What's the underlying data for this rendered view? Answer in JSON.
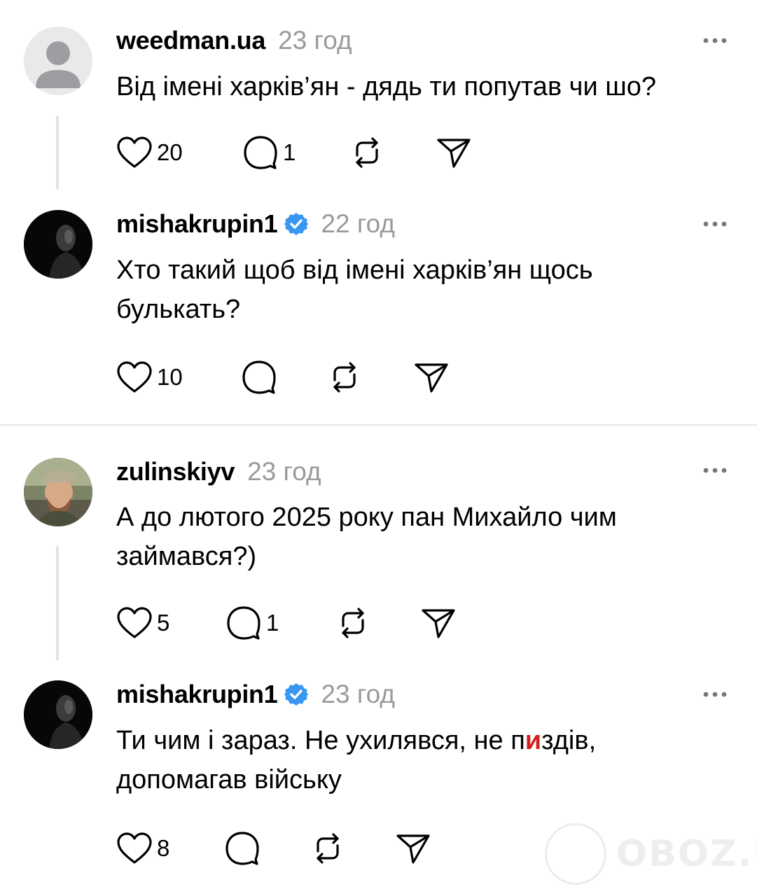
{
  "comments": [
    {
      "username": "weedman.ua",
      "time": "23 год",
      "text": "Від імені харків’ян - дядь ти попутав чи шо?",
      "likes": "20",
      "replies": "1",
      "verified": false
    },
    {
      "username": "mishakrupin1",
      "time": "22 год",
      "text": "Хто такий щоб від імені харків’ян щось булькать?",
      "likes": "10",
      "replies": "",
      "verified": true
    },
    {
      "username": "zulinskiyv",
      "time": "23 год",
      "text": "А до лютого 2025 року пан Михайло чим займався?)",
      "likes": "5",
      "replies": "1",
      "verified": false
    },
    {
      "username": "mishakrupin1",
      "time": "23 год",
      "text_part1": "Ти чим і зараз. Не ухилявся, не п",
      "text_redacted": "и",
      "text_part2": "здів, допомагав війську",
      "likes": "8",
      "replies": "",
      "verified": true
    }
  ],
  "icons": {
    "like": "heart-icon",
    "reply": "comment-bubble-icon",
    "repost": "repost-icon",
    "share": "send-icon",
    "more": "more-dots-icon",
    "verified": "verified-badge-icon"
  },
  "colors": {
    "verified": "#3897f0",
    "time": "#9a9a9a",
    "redaction": "#d21f1f"
  },
  "watermark": "OBOZ.UA"
}
